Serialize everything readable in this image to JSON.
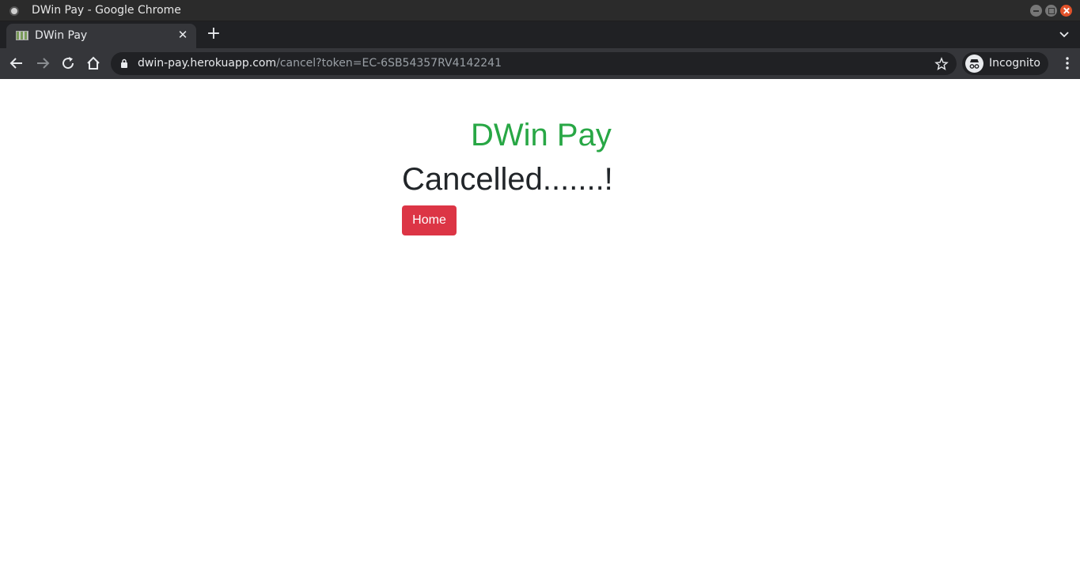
{
  "window": {
    "title": "DWin Pay - Google Chrome"
  },
  "tabs": [
    {
      "title": "DWin Pay",
      "active": true
    }
  ],
  "toolbar": {
    "url_host": "dwin-pay.herokuapp.com",
    "url_path": "/cancel?token=EC-6SB54357RV4142241",
    "profile_label": "Incognito"
  },
  "page": {
    "brand": "DWin Pay",
    "status": "Cancelled.......!",
    "home_button": "Home"
  },
  "colors": {
    "brand": "#28a745",
    "status_text": "#212529",
    "home_button_bg": "#dc3545"
  },
  "icons": {
    "back": "arrow-left-icon",
    "forward": "arrow-right-icon",
    "reload": "reload-icon",
    "home": "home-icon",
    "lock": "lock-icon",
    "bookmark": "star-icon",
    "incognito": "incognito-icon",
    "menu": "kebab-menu-icon",
    "new_tab": "plus-icon",
    "tab_close": "close-icon",
    "tab_search": "chevron-down-icon"
  }
}
